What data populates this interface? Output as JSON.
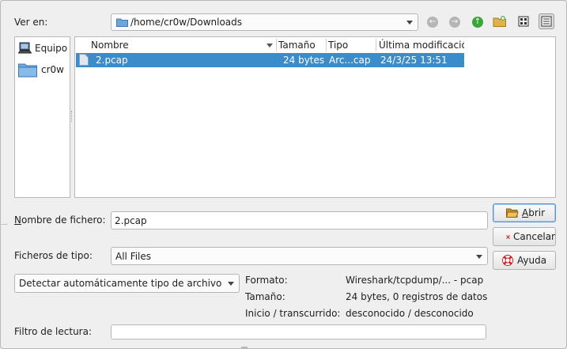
{
  "toolbar": {
    "look_in_label": "Ver en:",
    "path": "/home/cr0w/Downloads",
    "back_label": "←",
    "forward_label": "→",
    "up_label": "↑"
  },
  "sidebar": {
    "items": [
      {
        "label": "Equipo",
        "icon": "computer-icon"
      },
      {
        "label": "cr0w",
        "icon": "folder-icon"
      }
    ]
  },
  "file_list": {
    "columns": [
      "Nombre",
      "Tamaño",
      "Tipo",
      "Última modificación"
    ],
    "rows": [
      {
        "name": "2.pcap",
        "size": "24 bytes",
        "type": "Arc...cap",
        "modified": "24/3/25 13:51",
        "selected": true
      }
    ]
  },
  "filename": {
    "label_first": "N",
    "label_rest": "ombre de fichero:",
    "value": "2.pcap"
  },
  "filetype": {
    "label": "Ficheros de tipo:",
    "value": "All Files"
  },
  "format_detect": {
    "value": "Detectar automáticamente tipo de archivo"
  },
  "info": {
    "format_label": "Formato:",
    "format_value": "Wireshark/tcpdump/... - pcap",
    "size_label": "Tamaño:",
    "size_value": "24 bytes, 0 registros de datos",
    "start_label": "Inicio / transcurrido:",
    "start_value": "desconocido / desconocido"
  },
  "read_filter": {
    "label": "Filtro de lectura:",
    "value": ""
  },
  "buttons": {
    "open_first": "A",
    "open_rest": "brir",
    "cancel": "Cancelar",
    "help": "Ayuda"
  },
  "colors": {
    "selection": "#3b8ccb",
    "up_arrow": "#3aa63a",
    "disabled_nav": "#b5b5b5"
  }
}
